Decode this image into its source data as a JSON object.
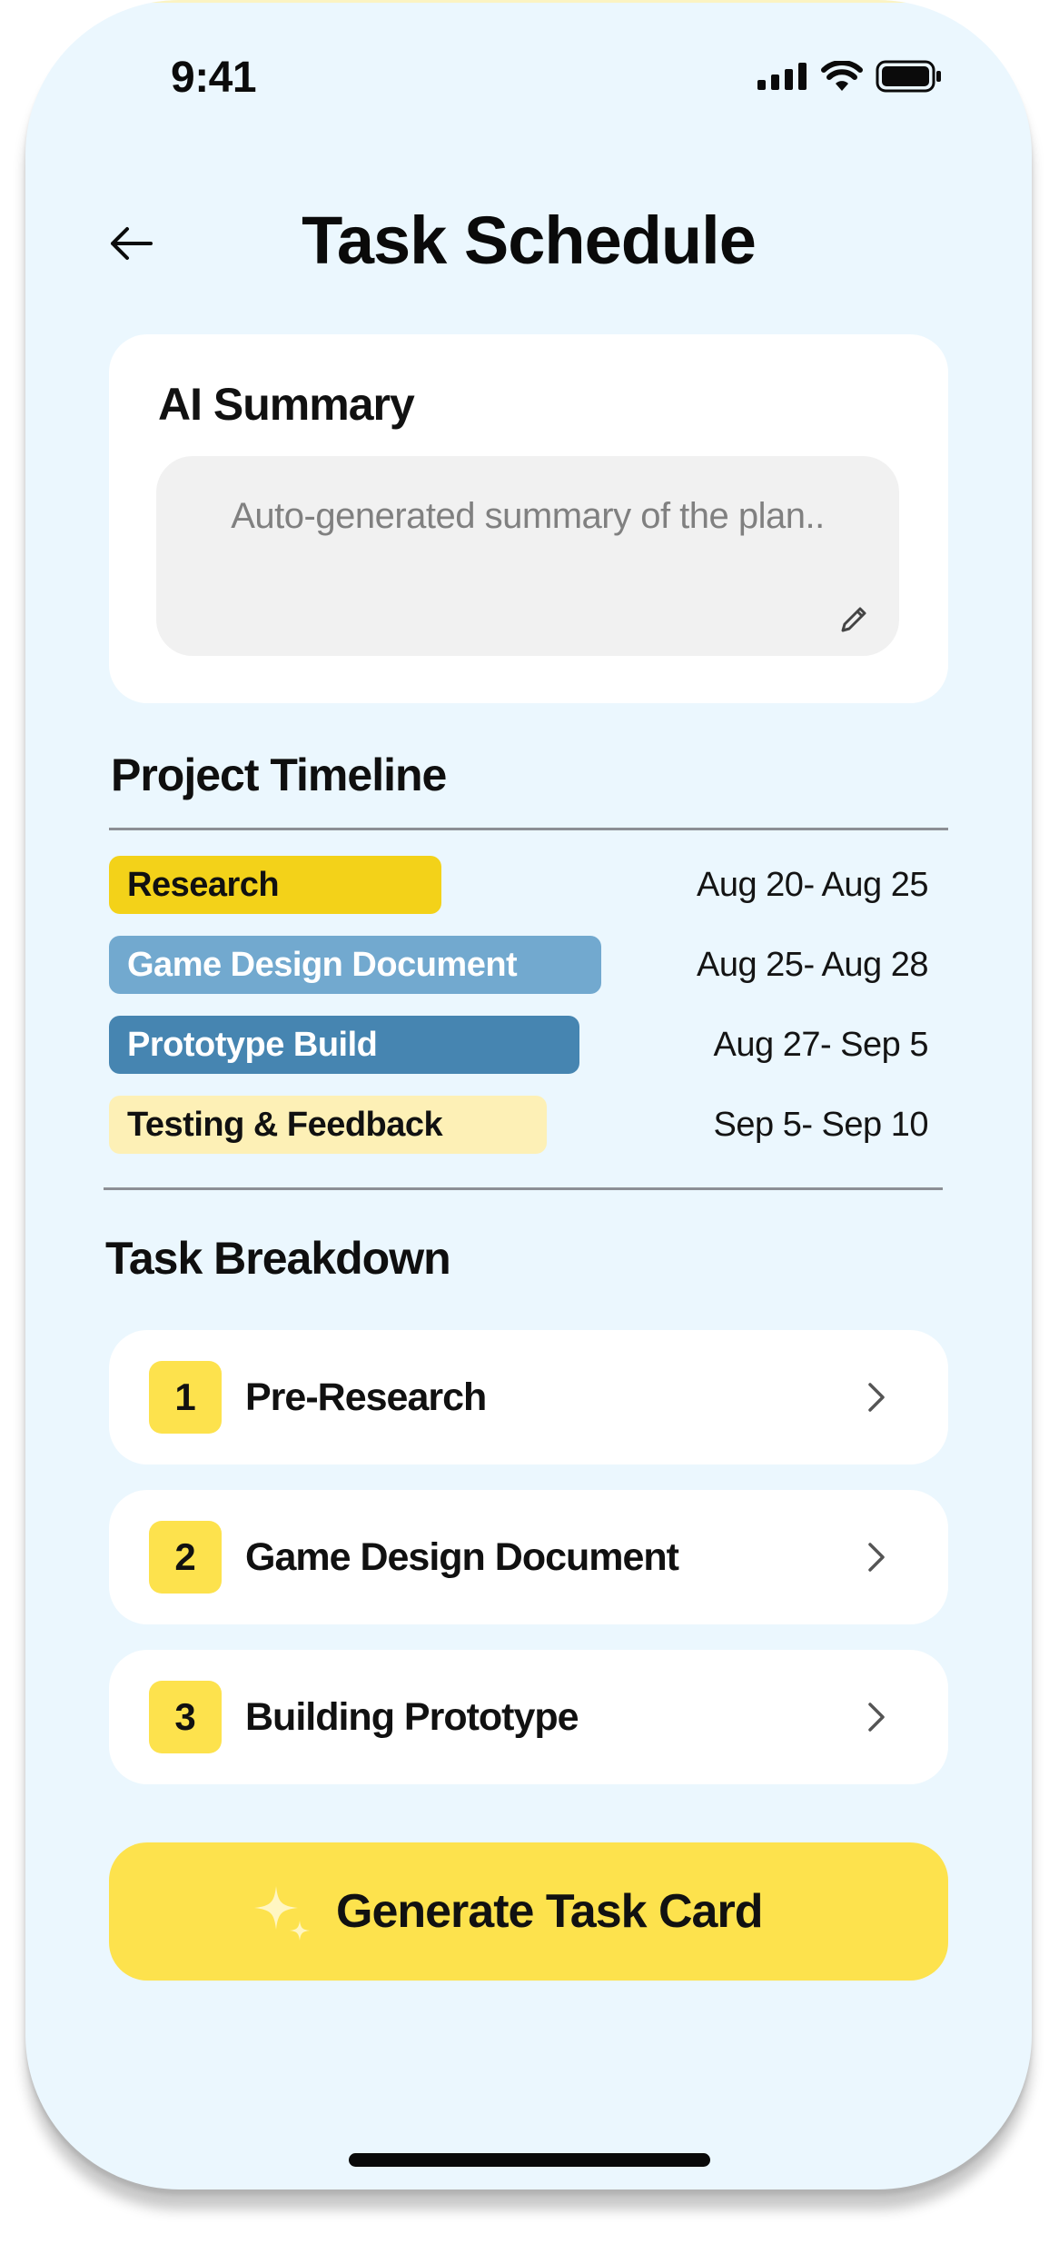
{
  "status_bar": {
    "time": "9:41",
    "icons": [
      "signal-icon",
      "wifi-icon",
      "battery-icon"
    ]
  },
  "header": {
    "title": "Task Schedule",
    "back_icon": "arrow-left-icon"
  },
  "ai_summary": {
    "heading": "AI Summary",
    "placeholder": "Auto-generated summary of the plan..",
    "edit_icon": "pencil-icon"
  },
  "timeline": {
    "title": "Project Timeline",
    "items": [
      {
        "label": "Research",
        "dates": "Aug 20- Aug 25",
        "color": "#f3d219",
        "text_color": "#111111"
      },
      {
        "label": "Game Design Document",
        "dates": "Aug 25- Aug 28",
        "color": "#72a9cf",
        "text_color": "#ffffff"
      },
      {
        "label": "Prototype Build",
        "dates": "Aug 27- Sep 5",
        "color": "#4685b1",
        "text_color": "#ffffff"
      },
      {
        "label": "Testing & Feedback",
        "dates": "Sep 5- Sep 10",
        "color": "#fdf0b6",
        "text_color": "#111111"
      }
    ]
  },
  "tasks": {
    "title": "Task Breakdown",
    "items": [
      {
        "number": "1",
        "label": "Pre-Research",
        "icon": "chevron-right-icon"
      },
      {
        "number": "2",
        "label": "Game Design Document",
        "icon": "chevron-right-icon"
      },
      {
        "number": "3",
        "label": "Building Prototype",
        "icon": "chevron-right-icon"
      }
    ]
  },
  "generate_button": {
    "label": "Generate Task Card",
    "icon": "sparkle-icon",
    "color": "#fde24d"
  },
  "colors": {
    "background": "#ebf7fe",
    "accent_yellow": "#fde24d",
    "card": "#ffffff"
  }
}
